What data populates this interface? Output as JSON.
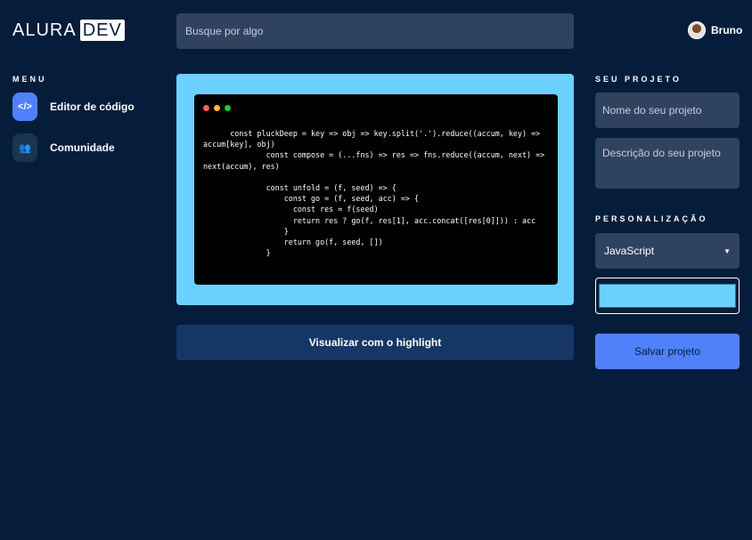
{
  "logo": {
    "alura": "ALURA",
    "dev": "DEV"
  },
  "search": {
    "placeholder": "Busque por algo"
  },
  "user": {
    "name": "Bruno"
  },
  "menu": {
    "title": "MENU",
    "items": [
      {
        "label": "Editor de código",
        "icon": "code-icon",
        "glyph": "</>"
      },
      {
        "label": "Comunidade",
        "icon": "users-icon",
        "glyph": "👥"
      }
    ]
  },
  "editor": {
    "code": "      const pluckDeep = key => obj => key.split('.').reduce((accum, key) =>\naccum[key], obj)\n              const compose = (...fns) => res => fns.reduce((accum, next) =>\nnext(accum), res)\n\n              const unfold = (f, seed) => {\n                  const go = (f, seed, acc) => {\n                    const res = f(seed)\n                    return res ? go(f, res[1], acc.concat([res[0]])) : acc\n                  }\n                  return go(f, seed, [])\n              }"
  },
  "highlight_button": {
    "label": "Visualizar com o highlight"
  },
  "project": {
    "title": "SEU PROJETO",
    "name_placeholder": "Nome do seu projeto",
    "description_placeholder": "Descrição do seu projeto"
  },
  "customization": {
    "title": "PERSONALIZAÇÃO",
    "language": "JavaScript",
    "color": "#6bd1ff"
  },
  "save_button": {
    "label": "Salvar projeto"
  },
  "colors": {
    "background": "#051d3b",
    "accent": "#5081fb",
    "editor_frame": "#6bd1ff"
  }
}
